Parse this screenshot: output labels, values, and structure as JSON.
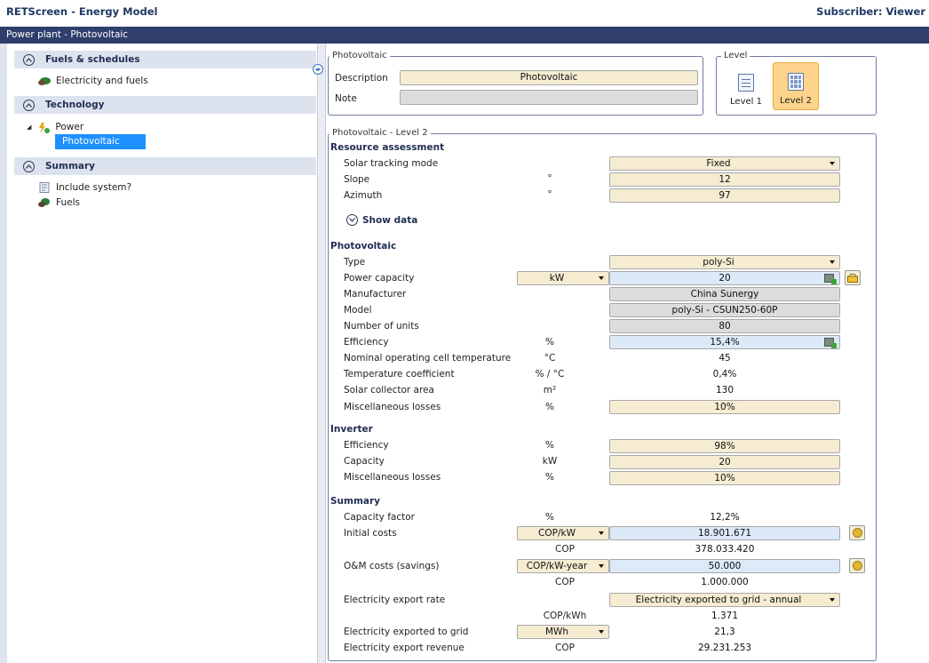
{
  "app": {
    "title": "RETScreen - Energy Model",
    "subscriber": "Subscriber: Viewer"
  },
  "path": "Power plant - Photovoltaic",
  "sidebar": {
    "sections": [
      {
        "label": "Fuels & schedules",
        "items": [
          "Electricity and fuels"
        ]
      },
      {
        "label": "Technology",
        "items": [
          "Power",
          "Photovoltaic"
        ]
      },
      {
        "label": "Summary",
        "items": [
          "Include system?",
          "Fuels"
        ]
      }
    ]
  },
  "photovoltaic_box": {
    "legend": "Photovoltaic",
    "description_label": "Description",
    "description_value": "Photovoltaic",
    "note_label": "Note",
    "note_value": ""
  },
  "level_box": {
    "legend": "Level",
    "level1": "Level 1",
    "level2": "Level 2"
  },
  "main": {
    "legend": "Photovoltaic - Level 2",
    "resource": {
      "title": "Resource assessment",
      "tracking_label": "Solar tracking mode",
      "tracking_value": "Fixed",
      "slope_label": "Slope",
      "slope_unit": "°",
      "slope_value": "12",
      "azimuth_label": "Azimuth",
      "azimuth_unit": "°",
      "azimuth_value": "97",
      "show_data": "Show data"
    },
    "pv": {
      "title": "Photovoltaic",
      "type_label": "Type",
      "type_value": "poly-Si",
      "capacity_label": "Power capacity",
      "capacity_unit": "kW",
      "capacity_value": "20",
      "manufacturer_label": "Manufacturer",
      "manufacturer_value": "China Sunergy",
      "model_label": "Model",
      "model_value": "poly-Si - CSUN250-60P",
      "units_label": "Number of units",
      "units_value": "80",
      "efficiency_label": "Efficiency",
      "efficiency_unit": "%",
      "efficiency_value": "15,4%",
      "noct_label": "Nominal operating cell temperature",
      "noct_unit": "°C",
      "noct_value": "45",
      "tempcoef_label": "Temperature coefficient",
      "tempcoef_unit": "% / °C",
      "tempcoef_value": "0,4%",
      "area_label": "Solar collector area",
      "area_unit": "m²",
      "area_value": "130",
      "misc_label": "Miscellaneous losses",
      "misc_unit": "%",
      "misc_value": "10%"
    },
    "inverter": {
      "title": "Inverter",
      "efficiency_label": "Efficiency",
      "efficiency_unit": "%",
      "efficiency_value": "98%",
      "capacity_label": "Capacity",
      "capacity_unit": "kW",
      "capacity_value": "20",
      "misc_label": "Miscellaneous losses",
      "misc_unit": "%",
      "misc_value": "10%"
    },
    "summary": {
      "title": "Summary",
      "cf_label": "Capacity factor",
      "cf_unit": "%",
      "cf_value": "12,2%",
      "initial_label": "Initial costs",
      "initial_unit": "COP/kW",
      "initial_value": "18.901.671",
      "initial_total_unit": "COP",
      "initial_total_value": "378.033.420",
      "om_label": "O&M costs (savings)",
      "om_unit": "COP/kW-year",
      "om_value": "50.000",
      "om_total_unit": "COP",
      "om_total_value": "1.000.000",
      "rate_label": "Electricity export rate",
      "rate_value": "Electricity exported to grid - annual",
      "rate_unit": "COP/kWh",
      "rate_num": "1.371",
      "exported_label": "Electricity exported to grid",
      "exported_unit": "MWh",
      "exported_value": "21,3",
      "revenue_label": "Electricity export revenue",
      "revenue_unit": "COP",
      "revenue_value": "29.231.253"
    }
  }
}
